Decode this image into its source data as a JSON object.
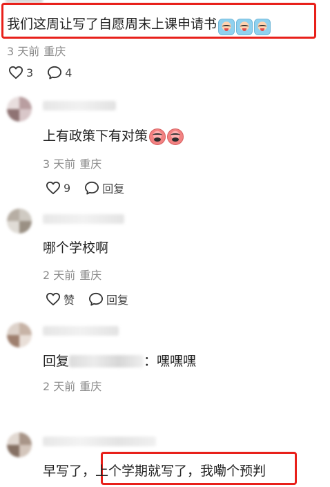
{
  "main_comment": {
    "text": "我们这周让写了自愿周末上课申请书",
    "emojis": [
      "crying-face-icon",
      "crying-face-icon",
      "crying-face-icon"
    ],
    "days": "3 天前",
    "location": "重庆",
    "likes": "3",
    "replies": "4",
    "highlight_color": "#e8201a"
  },
  "replies": [
    {
      "text": "上有政策下有对策",
      "emojis": [
        "angry-face-icon",
        "angry-face-icon"
      ],
      "days": "3 天前",
      "location": "重庆",
      "likes": "9",
      "reply_label": "回复"
    },
    {
      "text": "哪个学校啊",
      "days": "2 天前",
      "location": "重庆",
      "like_label": "赞",
      "reply_label": "回复"
    },
    {
      "text_prefix": "回复",
      "text_suffix": "：嘿嘿嘿",
      "days": "2 天前",
      "location": "重庆"
    },
    {
      "text_prefix": "早写了，",
      "text_highlight": "上个学期就写了，我嘞个预判"
    }
  ]
}
